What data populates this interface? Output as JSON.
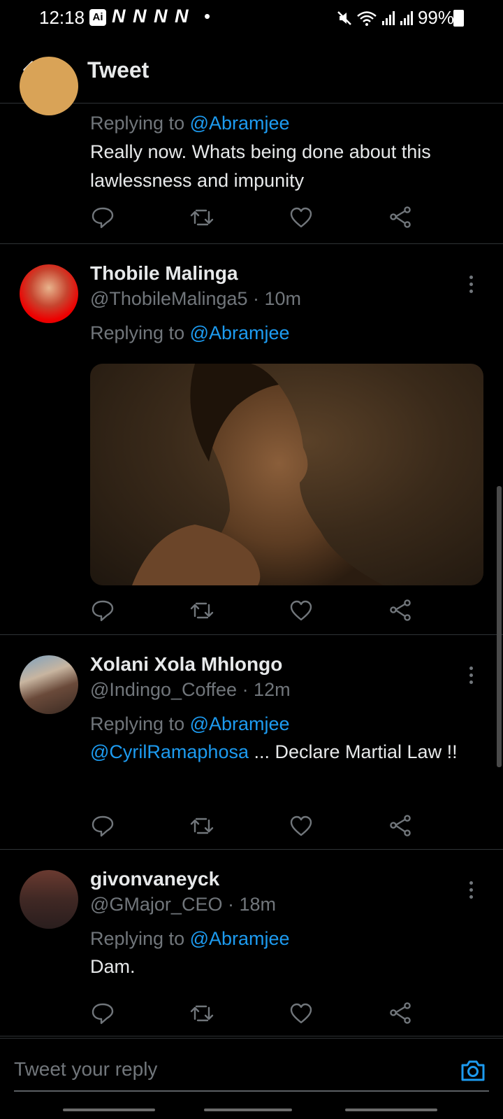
{
  "status_bar": {
    "time": "12:18",
    "ai_badge": "Ai",
    "notif_icons": [
      "N",
      "N",
      "N",
      "N"
    ],
    "dot": "•",
    "battery": "99%"
  },
  "header": {
    "title": "Tweet"
  },
  "tweets": [
    {
      "replying_prefix": "Replying to ",
      "replying_to": "@Abramjee",
      "text": "Really now. Whats being done about this lawlessness and impunity"
    },
    {
      "name": "Thobile Malinga",
      "handle": "@ThobileMalinga5 · 10m",
      "replying_prefix": "Replying to ",
      "replying_to": "@Abramjee"
    },
    {
      "name": "Xolani Xola Mhlongo",
      "handle": "@Indingo_Coffee · 12m",
      "replying_prefix": "Replying to ",
      "replying_to": "@Abramjee",
      "mention": "@CyrilRamaphosa",
      "text": " ... Declare Martial Law !!"
    },
    {
      "name": "givonvaneyck",
      "handle": "@GMajor_CEO · 18m",
      "replying_prefix": "Replying to ",
      "replying_to": "@Abramjee",
      "text": "Dam."
    }
  ],
  "reply_bar": {
    "placeholder": "Tweet your reply"
  },
  "colors": {
    "link": "#1d9bf0",
    "muted": "#71767b",
    "divider": "#2f3336"
  }
}
